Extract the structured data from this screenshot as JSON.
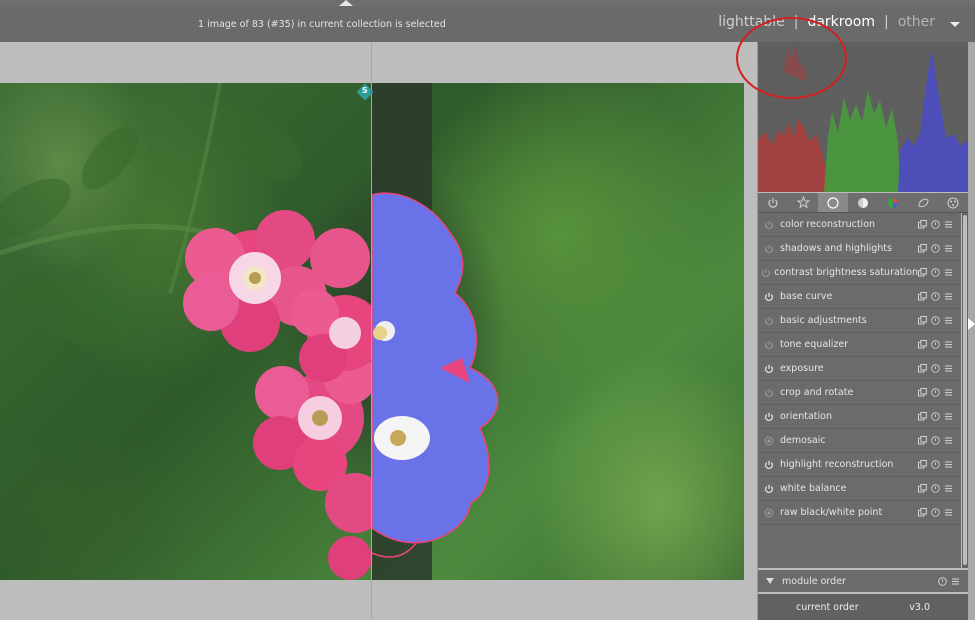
{
  "header": {
    "status": "1 image of 83 (#35) in current collection is selected",
    "views": [
      "lighttable",
      "darkroom",
      "other"
    ],
    "separator": "|",
    "active_view": "darkroom"
  },
  "tabs": [
    {
      "icon": "power-icon"
    },
    {
      "icon": "star-icon"
    },
    {
      "icon": "circle-icon",
      "active": true
    },
    {
      "icon": "half-circle-icon"
    },
    {
      "icon": "color-wheel-icon"
    },
    {
      "icon": "correct-icon"
    },
    {
      "icon": "effect-icon"
    }
  ],
  "modules": [
    {
      "name": "color reconstruction",
      "on": false
    },
    {
      "name": "shadows and highlights",
      "on": false
    },
    {
      "name": "contrast brightness saturation",
      "on": false
    },
    {
      "name": "base curve",
      "on": true
    },
    {
      "name": "basic adjustments",
      "on": false
    },
    {
      "name": "tone equalizer",
      "on": false
    },
    {
      "name": "exposure",
      "on": true
    },
    {
      "name": "crop and rotate",
      "on": false
    },
    {
      "name": "orientation",
      "on": true
    },
    {
      "name": "demosaic",
      "on": "always"
    },
    {
      "name": "highlight reconstruction",
      "on": true
    },
    {
      "name": "white balance",
      "on": true
    },
    {
      "name": "raw black/white point",
      "on": "always"
    }
  ],
  "module_order": {
    "label": "module order",
    "current_label": "current order",
    "current_value": "v3.0"
  },
  "split_handle_label": "S",
  "colors": {
    "accent_teal": "#5fc6c6",
    "annotation_red": "#d42020",
    "overexposure_blue": "#6a72e8"
  }
}
